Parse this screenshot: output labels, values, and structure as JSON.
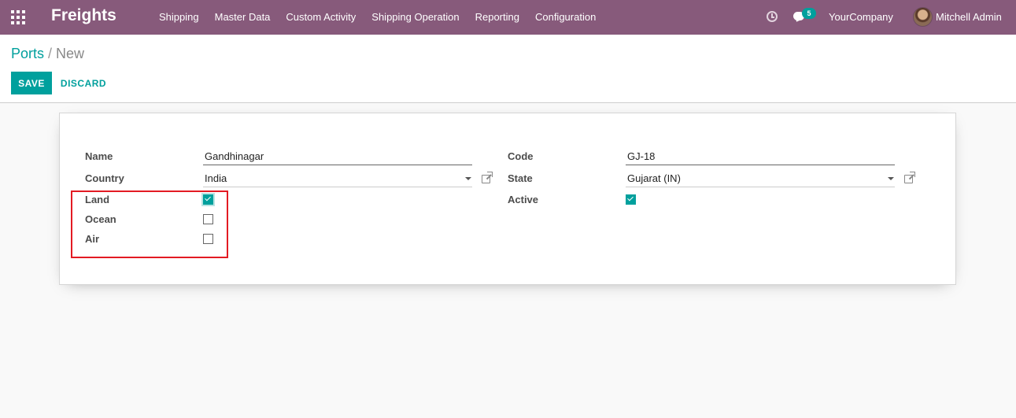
{
  "navbar": {
    "brand": "Freights",
    "menu": [
      "Shipping",
      "Master Data",
      "Custom Activity",
      "Shipping Operation",
      "Reporting",
      "Configuration"
    ],
    "messages_count": "5",
    "company": "YourCompany",
    "user": "Mitchell Admin",
    "color": "#875a7b"
  },
  "breadcrumb": {
    "parent": "Ports",
    "separator": "/",
    "current": "New"
  },
  "buttons": {
    "save": "SAVE",
    "discard": "DISCARD"
  },
  "form": {
    "name_label": "Name",
    "name_value": "Gandhinagar",
    "country_label": "Country",
    "country_value": "India",
    "land_label": "Land",
    "land_checked": true,
    "ocean_label": "Ocean",
    "ocean_checked": false,
    "air_label": "Air",
    "air_checked": false,
    "code_label": "Code",
    "code_value": "GJ-18",
    "state_label": "State",
    "state_value": "Gujarat (IN)",
    "active_label": "Active",
    "active_checked": true
  },
  "colors": {
    "accent": "#00a09d",
    "highlight": "#e31b23"
  }
}
